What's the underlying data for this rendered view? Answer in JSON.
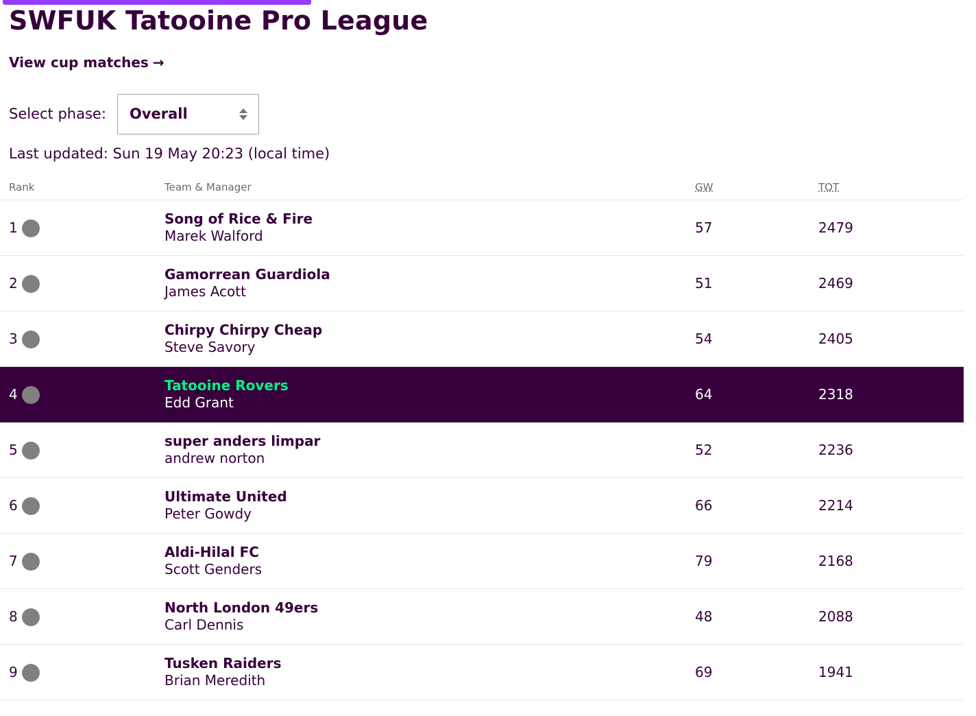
{
  "header": {
    "title": "SWFUK Tatooine Pro League",
    "cup_link": "View cup matches",
    "cup_arrow": "→"
  },
  "phase": {
    "label": "Select phase:",
    "selected": "Overall"
  },
  "last_updated": "Last updated: Sun 19 May 20:23 (local time)",
  "colors": {
    "primary": "#37003c",
    "accent_bar": "#963cff",
    "highlight_text": "#05f083",
    "movement_neutral": "#808080"
  },
  "table": {
    "columns": {
      "rank": "Rank",
      "team": "Team & Manager",
      "gw": "GW",
      "tot": "TOT"
    },
    "rows": [
      {
        "rank": "1",
        "team": "Song of Rice & Fire",
        "manager": "Marek Walford",
        "gw": "57",
        "tot": "2479",
        "highlight": false,
        "movement": "same"
      },
      {
        "rank": "2",
        "team": "Gamorrean Guardiola",
        "manager": "James Acott",
        "gw": "51",
        "tot": "2469",
        "highlight": false,
        "movement": "same"
      },
      {
        "rank": "3",
        "team": "Chirpy Chirpy Cheap",
        "manager": "Steve Savory",
        "gw": "54",
        "tot": "2405",
        "highlight": false,
        "movement": "same"
      },
      {
        "rank": "4",
        "team": "Tatooine Rovers",
        "manager": "Edd Grant",
        "gw": "64",
        "tot": "2318",
        "highlight": true,
        "movement": "same"
      },
      {
        "rank": "5",
        "team": "super anders limpar",
        "manager": "andrew norton",
        "gw": "52",
        "tot": "2236",
        "highlight": false,
        "movement": "same"
      },
      {
        "rank": "6",
        "team": "Ultimate United",
        "manager": "Peter Gowdy",
        "gw": "66",
        "tot": "2214",
        "highlight": false,
        "movement": "same"
      },
      {
        "rank": "7",
        "team": "Aldi-Hilal FC",
        "manager": "Scott Genders",
        "gw": "79",
        "tot": "2168",
        "highlight": false,
        "movement": "same"
      },
      {
        "rank": "8",
        "team": "North London 49ers",
        "manager": "Carl Dennis",
        "gw": "48",
        "tot": "2088",
        "highlight": false,
        "movement": "same"
      },
      {
        "rank": "9",
        "team": "Tusken Raiders",
        "manager": "Brian Meredith",
        "gw": "69",
        "tot": "1941",
        "highlight": false,
        "movement": "same"
      }
    ]
  }
}
